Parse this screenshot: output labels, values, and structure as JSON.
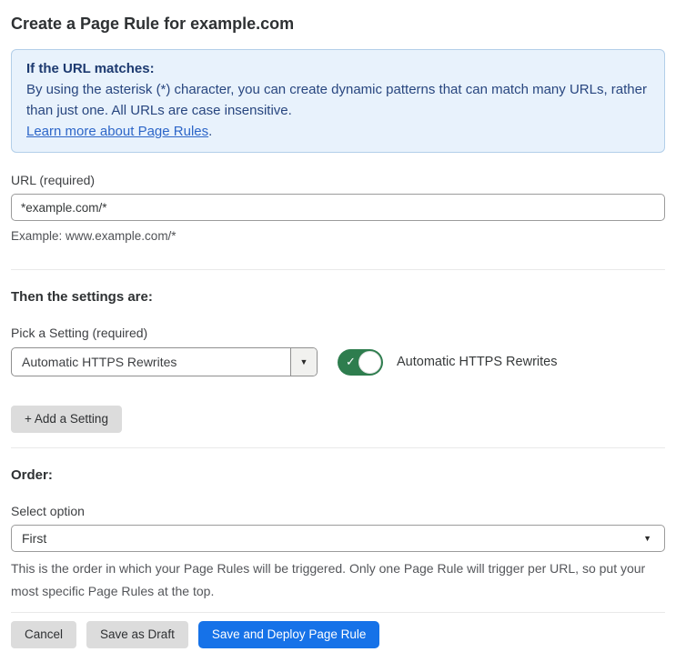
{
  "page": {
    "title": "Create a Page Rule for example.com"
  },
  "info_box": {
    "heading": "If the URL matches:",
    "body": "By using the asterisk (*) character, you can create dynamic patterns that can match many URLs, rather than just one. All URLs are case insensitive.",
    "link_label": "Learn more about Page Rules",
    "link_suffix": "."
  },
  "url_section": {
    "label": "URL (required)",
    "value": "*example.com/*",
    "helper": "Example: www.example.com/*"
  },
  "settings_section": {
    "heading": "Then the settings are:",
    "picker_label": "Pick a Setting (required)",
    "selected_setting": "Automatic HTTPS Rewrites",
    "toggle_label": "Automatic HTTPS Rewrites",
    "toggle_state": "on",
    "add_setting_label": "+ Add a Setting"
  },
  "order_section": {
    "heading": "Order:",
    "label": "Select option",
    "selected_option": "First",
    "helper": "This is the order in which your Page Rules will be triggered. Only one Page Rule will trigger per URL, so put your most specific Page Rules at the top."
  },
  "footer": {
    "cancel_label": "Cancel",
    "save_draft_label": "Save as Draft",
    "save_deploy_label": "Save and Deploy Page Rule"
  },
  "icons": {
    "dropdown_arrow": "▼",
    "select_caret": "▼",
    "toggle_check": "✓"
  },
  "colors": {
    "accent_blue": "#1672e8",
    "toggle_green": "#2e7d4e",
    "info_background": "#e8f2fc",
    "info_border": "#b3cfe9",
    "link_blue": "#2d66c8"
  }
}
